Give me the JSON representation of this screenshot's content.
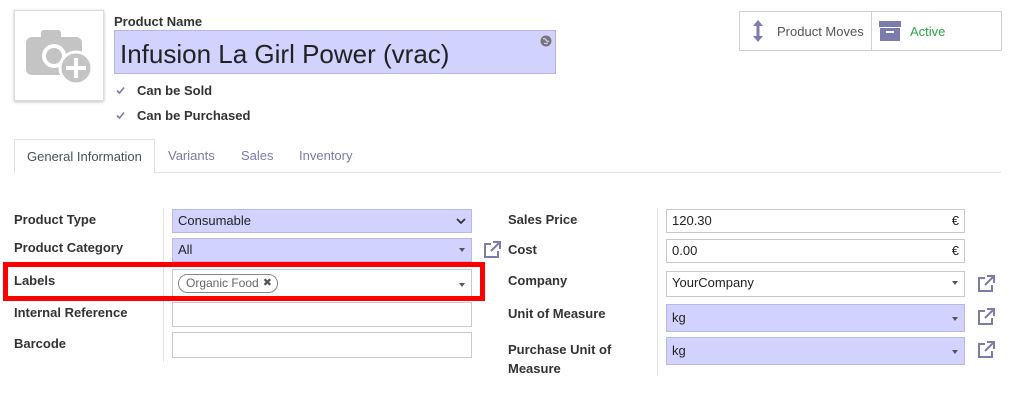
{
  "product": {
    "name_label": "Product Name",
    "name_value": "Infusion La Girl Power (vrac)",
    "can_be_sold_label": "Can be Sold",
    "can_be_purchased_label": "Can be Purchased"
  },
  "smart_buttons": {
    "moves_label": "Product Moves",
    "active_label": "Active"
  },
  "tabs": [
    {
      "label": "General Information",
      "active": true
    },
    {
      "label": "Variants"
    },
    {
      "label": "Sales"
    },
    {
      "label": "Inventory"
    }
  ],
  "left_fields": {
    "product_type_label": "Product Type",
    "product_type_value": "Consumable",
    "product_category_label": "Product Category",
    "product_category_value": "All",
    "labels_label": "Labels",
    "labels_tag": "Organic Food",
    "labels_tag_remove": "✖",
    "internal_reference_label": "Internal Reference",
    "internal_reference_value": "",
    "barcode_label": "Barcode",
    "barcode_value": ""
  },
  "right_fields": {
    "sales_price_label": "Sales Price",
    "sales_price_value": "120.30",
    "cost_label": "Cost",
    "cost_value": "0.00",
    "currency_symbol": "€",
    "company_label": "Company",
    "company_value": "YourCompany",
    "uom_label": "Unit of Measure",
    "uom_value": "kg",
    "purchase_uom_label_line1": "Purchase Unit of",
    "purchase_uom_label_line2": "Measure",
    "purchase_uom_value": "kg"
  },
  "colors": {
    "required_bg": "#d2d2ff",
    "link": "#7c7bad",
    "active_green": "#28a745",
    "highlight": "#ff0000"
  },
  "icons": {
    "camera": "camera-plus-icon",
    "language": "globe-icon",
    "moves": "vertical-arrows-icon",
    "archive": "archive-box-icon",
    "external": "external-link-icon"
  }
}
